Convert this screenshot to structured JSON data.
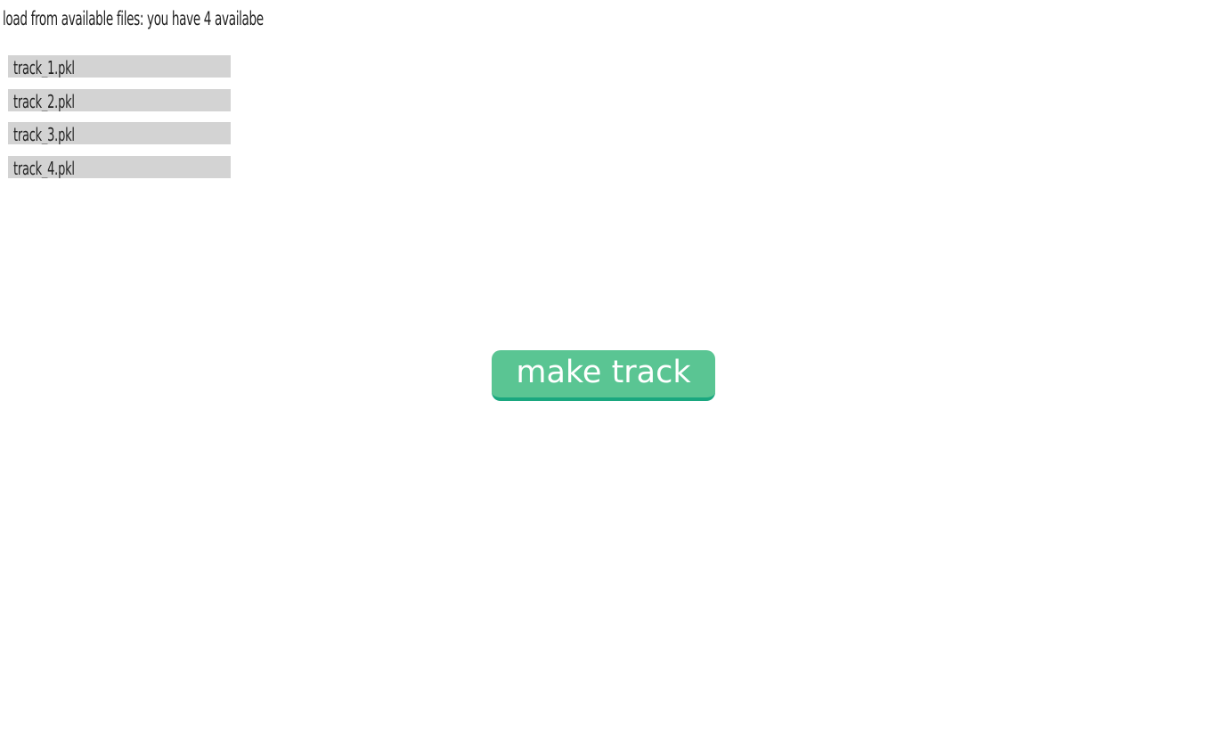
{
  "header": {
    "text": "load from available files: you have 4 availabe"
  },
  "files": [
    {
      "label": "track_1.pkl"
    },
    {
      "label": "track_2.pkl"
    },
    {
      "label": "track_3.pkl"
    },
    {
      "label": "track_4.pkl"
    }
  ],
  "actions": {
    "make_track_label": "make track"
  },
  "colors": {
    "file_item_bg": "#d3d3d3",
    "button_bg": "#5ac593",
    "button_shadow": "#1aa77f"
  }
}
